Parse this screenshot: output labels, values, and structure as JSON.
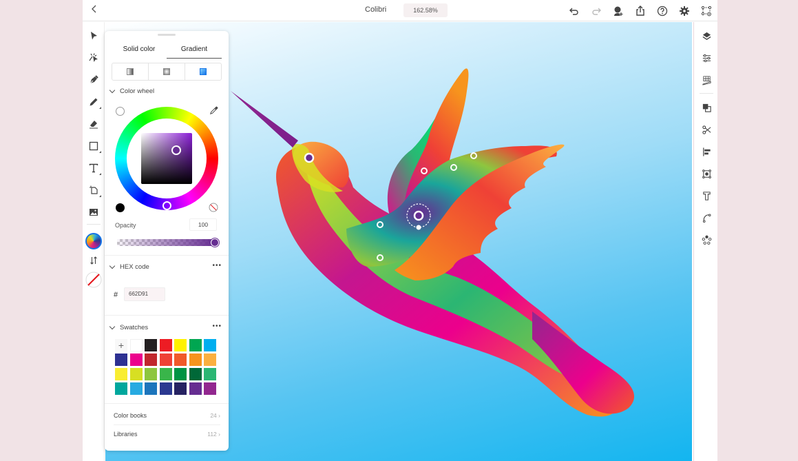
{
  "topbar": {
    "back_icon": "chevron-left-icon",
    "title": "Colibri",
    "zoom": "162.58%",
    "icons": [
      "undo-icon",
      "redo-icon",
      "invite-user-icon",
      "share-icon",
      "help-icon",
      "settings-icon",
      "prototype-icon"
    ]
  },
  "left_toolbar": {
    "tools": [
      "selection-icon",
      "direct-selection-icon",
      "pen-icon",
      "pencil-icon",
      "eraser-icon",
      "rectangle-icon",
      "type-icon",
      "artboard-icon",
      "image-icon"
    ],
    "fill_color": "gradient",
    "swap_icon": "swap-fill-stroke-icon",
    "stroke": "none"
  },
  "right_toolbar": {
    "tools": [
      "layers-icon",
      "properties-icon",
      "perspective-grid-icon",
      "arrange-icon",
      "scissors-icon",
      "align-icon",
      "image-trace-icon",
      "type-properties-icon",
      "path-icon",
      "repeat-icon"
    ]
  },
  "color_panel": {
    "tabs": [
      {
        "label": "Solid color",
        "active": false
      },
      {
        "label": "Gradient",
        "active": true
      }
    ],
    "gradient_types": [
      "linear-gradient",
      "radial-gradient",
      "freeform-gradient"
    ],
    "active_gradient_type": "freeform-gradient",
    "color_wheel": {
      "label": "Color wheel",
      "selected_color": "#662D91"
    },
    "opacity": {
      "label": "Opacity",
      "value": "100"
    },
    "hex": {
      "label": "HEX code",
      "hash": "#",
      "value": "662D91",
      "more": "•••"
    },
    "swatches": {
      "label": "Swatches",
      "more": "•••",
      "add_label": "+",
      "colors": [
        "#ffffff",
        "#231f20",
        "#ed1c24",
        "#fff200",
        "#00a651",
        "#00aeef",
        "#2e3192",
        "#ec008c",
        "#c1272d",
        "#ef4136",
        "#f15a29",
        "#f7941d",
        "#fbb040",
        "#f9ed32",
        "#d7df23",
        "#8dc63f",
        "#39b54a",
        "#009444",
        "#006838",
        "#2bb673",
        "#00a79d",
        "#27aae1",
        "#1c75bc",
        "#2b3990",
        "#262262",
        "#662d91",
        "#92278f"
      ]
    },
    "color_books": {
      "label": "Color books",
      "count": "24"
    },
    "libraries": {
      "label": "Libraries",
      "count": "112"
    }
  },
  "canvas": {
    "artwork": "hummingbird"
  }
}
